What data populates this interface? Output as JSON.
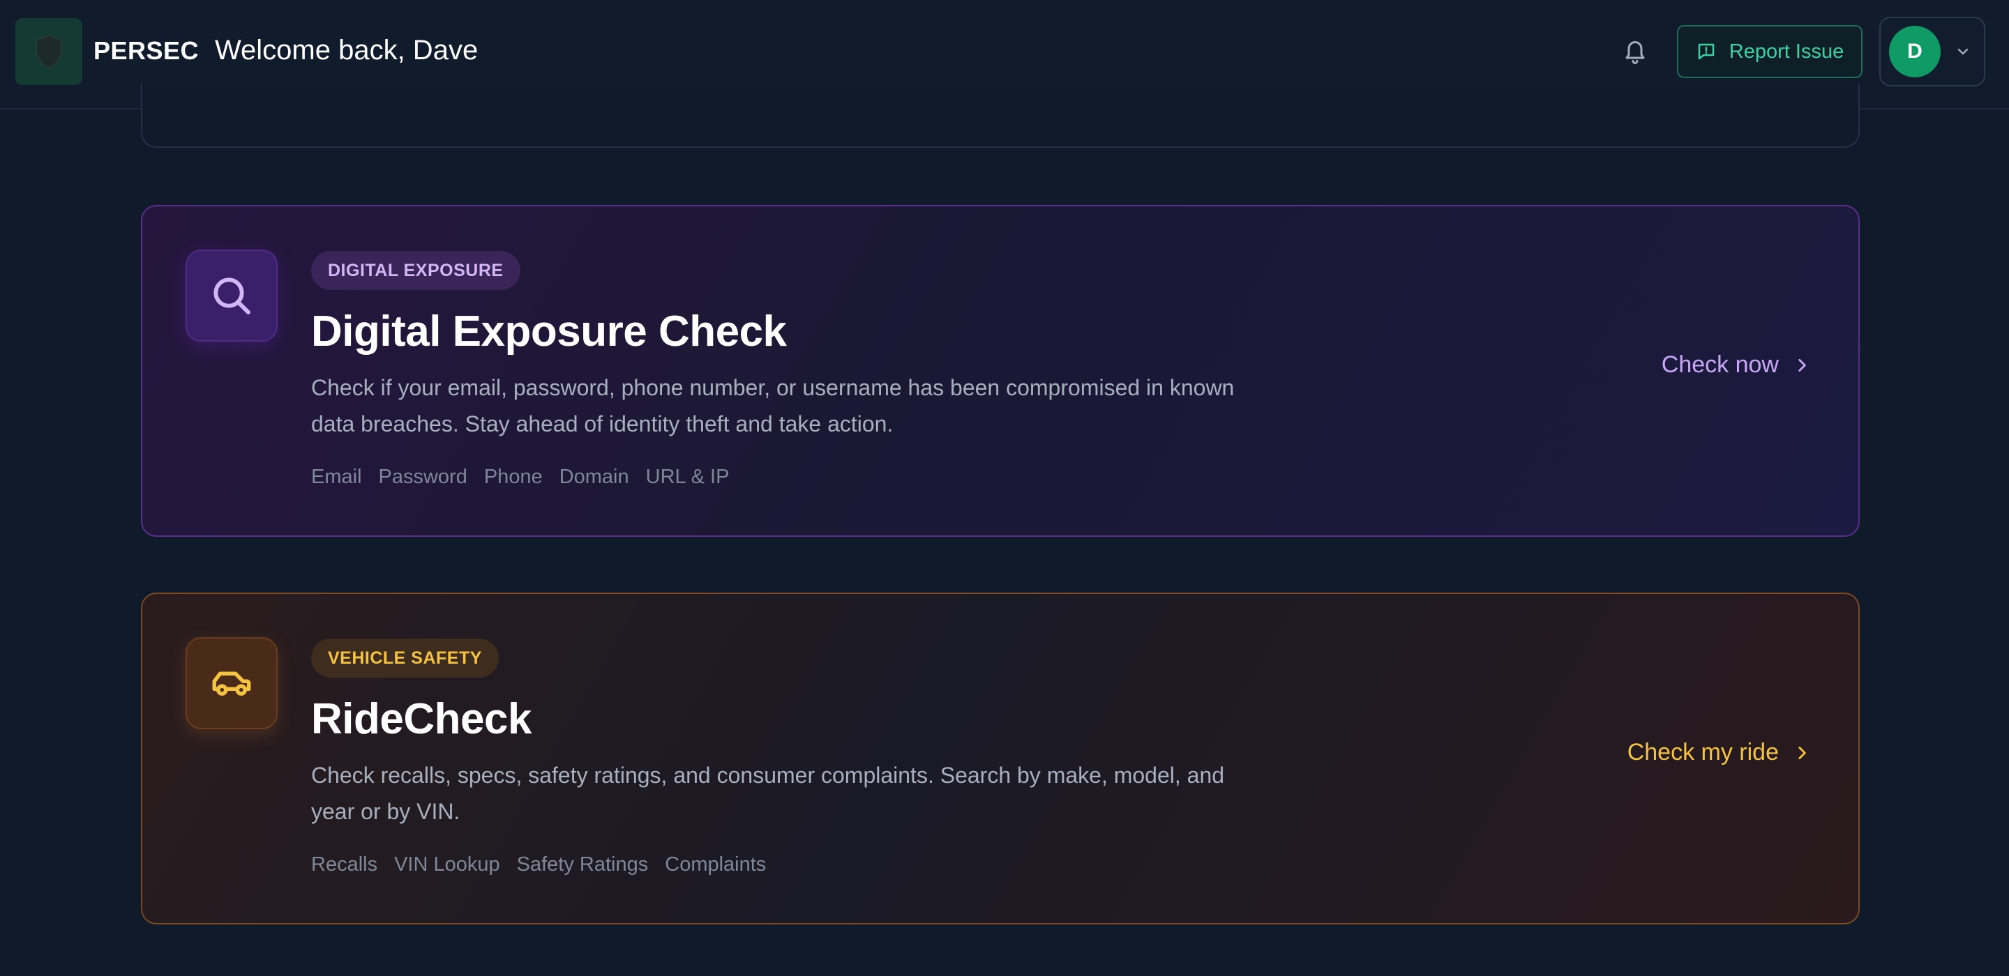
{
  "header": {
    "brand": "PERSEC",
    "welcome": "Welcome back, Dave",
    "report_label": "Report Issue",
    "avatar_initial": "D"
  },
  "icons": {
    "logo": "shield-icon",
    "notifications": "bell-icon",
    "report": "message-alert-icon",
    "user_menu": "chevron-down-icon",
    "digital": "search-icon",
    "vehicle": "car-icon",
    "cta": "chevron-right-icon"
  },
  "colors": {
    "accent_green": "#3fd1a1",
    "avatar_green": "#0f9a66",
    "digital_purple": "#c9a6f5",
    "vehicle_amber": "#f5c343"
  },
  "cards": [
    {
      "badge": "DIGITAL EXPOSURE",
      "title": "Digital Exposure Check",
      "description": "Check if your email, password, phone number, or username has been compromised in known data breaches. Stay ahead of identity theft and take action.",
      "tags": [
        "Email",
        "Password",
        "Phone",
        "Domain",
        "URL & IP"
      ],
      "cta": "Check now"
    },
    {
      "badge": "VEHICLE SAFETY",
      "title": "RideCheck",
      "description": "Check recalls, specs, safety ratings, and consumer complaints. Search by make, model, and year or by VIN.",
      "tags": [
        "Recalls",
        "VIN Lookup",
        "Safety Ratings",
        "Complaints"
      ],
      "cta": "Check my ride"
    }
  ]
}
